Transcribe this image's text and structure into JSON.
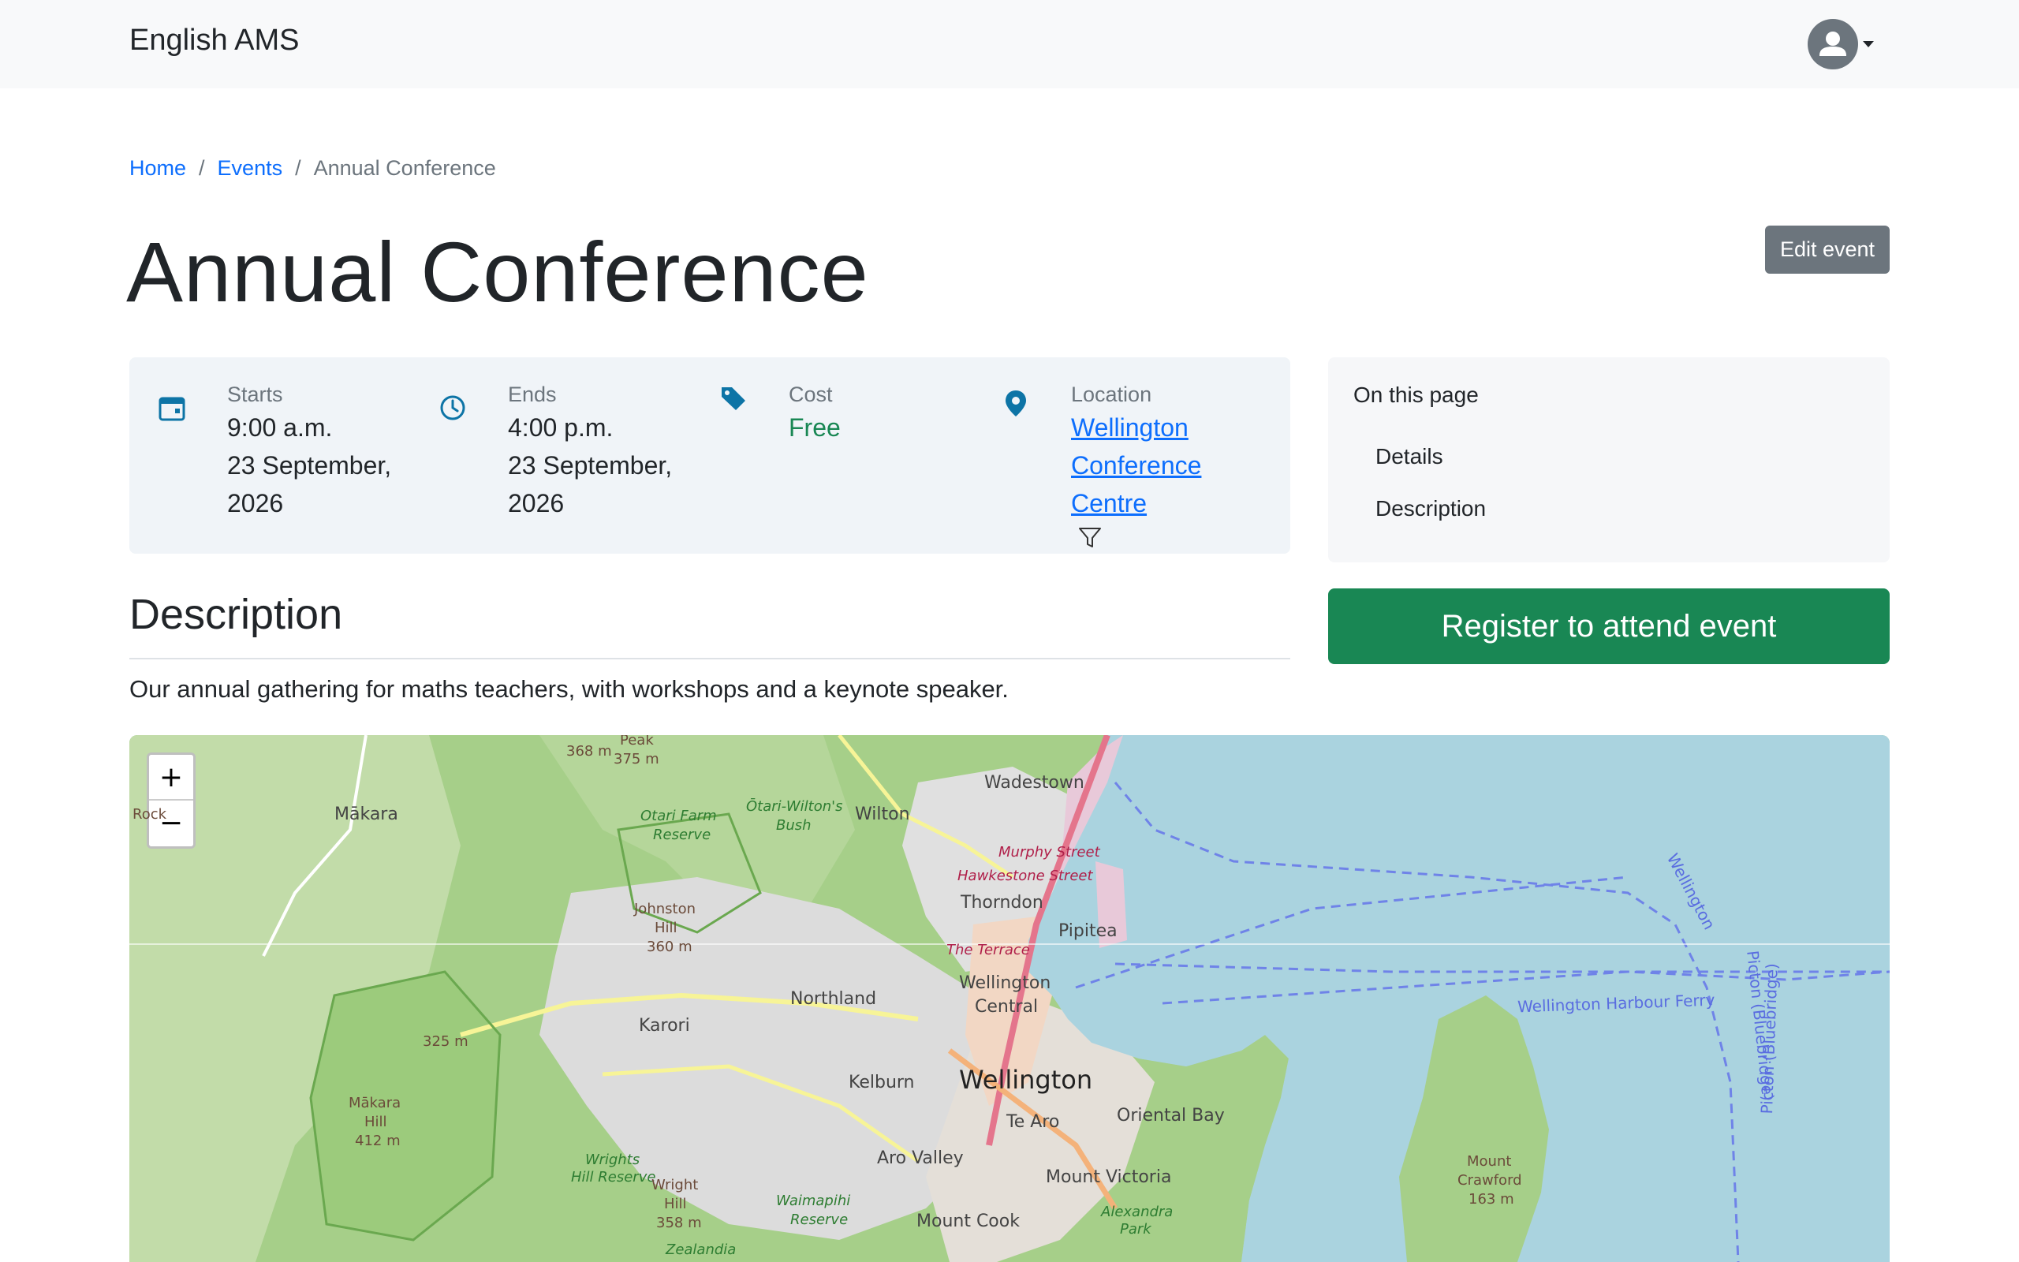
{
  "navbar": {
    "brand": "English AMS"
  },
  "breadcrumb": [
    {
      "label": "Home"
    },
    {
      "label": "Events"
    },
    {
      "label": "Annual Conference"
    }
  ],
  "page": {
    "title": "Annual Conference",
    "edit_label": "Edit event"
  },
  "details": {
    "starts": {
      "label": "Starts",
      "time": "9:00 a.m.",
      "date_line1": "23 September,",
      "date_line2": "2026",
      "icon": "calendar-icon"
    },
    "ends": {
      "label": "Ends",
      "time": "4:00 p.m.",
      "date_line1": "23 September,",
      "date_line2": "2026",
      "icon": "clock-icon"
    },
    "cost": {
      "label": "Cost",
      "value": "Free",
      "icon": "tag-icon"
    },
    "location": {
      "label": "Location",
      "line1": "Wellington",
      "line2": "Conference Centre",
      "icon": "map-pin-icon"
    }
  },
  "toc": {
    "title": "On this page",
    "items": [
      {
        "label": "Details"
      },
      {
        "label": "Description"
      }
    ]
  },
  "register": {
    "label": "Register to attend event"
  },
  "description": {
    "heading": "Description",
    "text": "Our annual gathering for maths teachers, with workshops and a keynote speaker."
  },
  "map": {
    "zoom_in": "+",
    "zoom_out": "−",
    "labels": {
      "makara": "Mākara",
      "wadestown": "Wadestown",
      "wilton": "Wilton",
      "thorndon": "Thorndon",
      "pipitea": "Pipitea",
      "northland": "Northland",
      "wellington_central_1": "Wellington",
      "wellington_central_2": "Central",
      "karori": "Karori",
      "kelburn": "Kelburn",
      "wellington": "Wellington",
      "oriental_bay": "Oriental Bay",
      "te_aro": "Te Aro",
      "aro_valley": "Aro Valley",
      "mount_victoria": "Mount Victoria",
      "mount_cook": "Mount Cook",
      "murphy_street": "Murphy Street",
      "hawkestone_street": "Hawkestone Street",
      "the_terrace": "The Terrace",
      "otari_farm_1": "Otari Farm",
      "otari_farm_2": "Reserve",
      "otari_wilton_1": "Ōtari-Wilton's",
      "otari_wilton_2": "Bush",
      "johnston_1": "Johnston",
      "johnston_2": "Hill",
      "johnston_3": "360 m",
      "wrights_1": "Wrights",
      "wrights_2": "Hill Reserve",
      "wright_hill_1": "Wright",
      "wright_hill_2": "Hill",
      "wright_hill_3": "358 m",
      "waimapihi_1": "Waimapihi",
      "waimapihi_2": "Reserve",
      "zealandia": "Zealandia",
      "alexandra_1": "Alexandra",
      "alexandra_2": "Park",
      "makara_hill_1": "Mākara",
      "makara_hill_2": "Hill",
      "makara_hill_3": "412 m",
      "elev_325": "325 m",
      "elev_368": "368 m",
      "elev_375": "375 m",
      "peak": "Peak",
      "rock": "Rock",
      "ferry": "Wellington Harbour Ferry",
      "wellington_route": "Wellington",
      "picton_1": "Picton (Bluebridge)",
      "picton_2": "Picton (Bluebridge)",
      "mount_crawford_1": "Mount",
      "mount_crawford_2": "Crawford",
      "mount_crawford_3": "163 m"
    }
  }
}
